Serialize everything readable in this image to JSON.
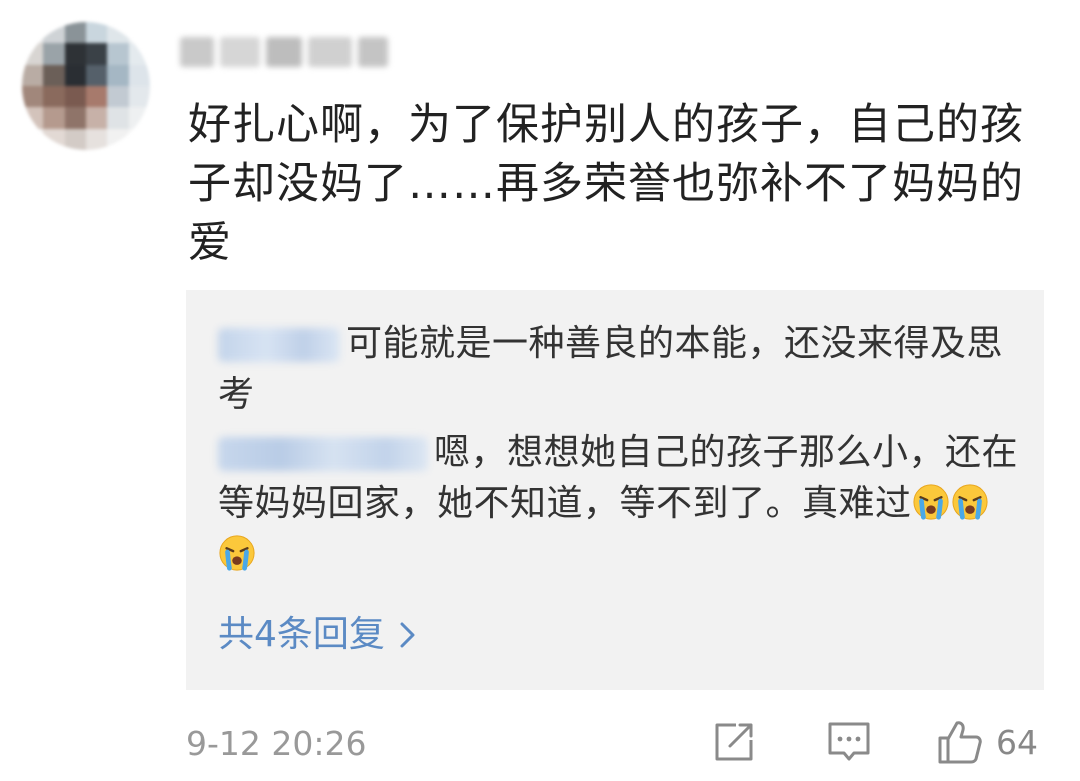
{
  "comment": {
    "text": "好扎心啊，为了保护别人的孩子，自己的孩子却没妈了……再多荣誉也弥补不了妈妈的爱",
    "timestamp": "9-12 20:26",
    "like_count": "64"
  },
  "replies": [
    {
      "text": "可能就是一种善良的本能，还没来得及思考"
    },
    {
      "text": "嗯，想想她自己的孩子那么小，还在等妈妈回家，她不知道，等不到了。真难过",
      "emoji": "crying-face-icon"
    }
  ],
  "more_replies_label": "共4条回复",
  "colors": {
    "link": "#5b8ac4",
    "text": "#222222",
    "muted": "#999999",
    "reply_bg": "#f2f2f2"
  }
}
